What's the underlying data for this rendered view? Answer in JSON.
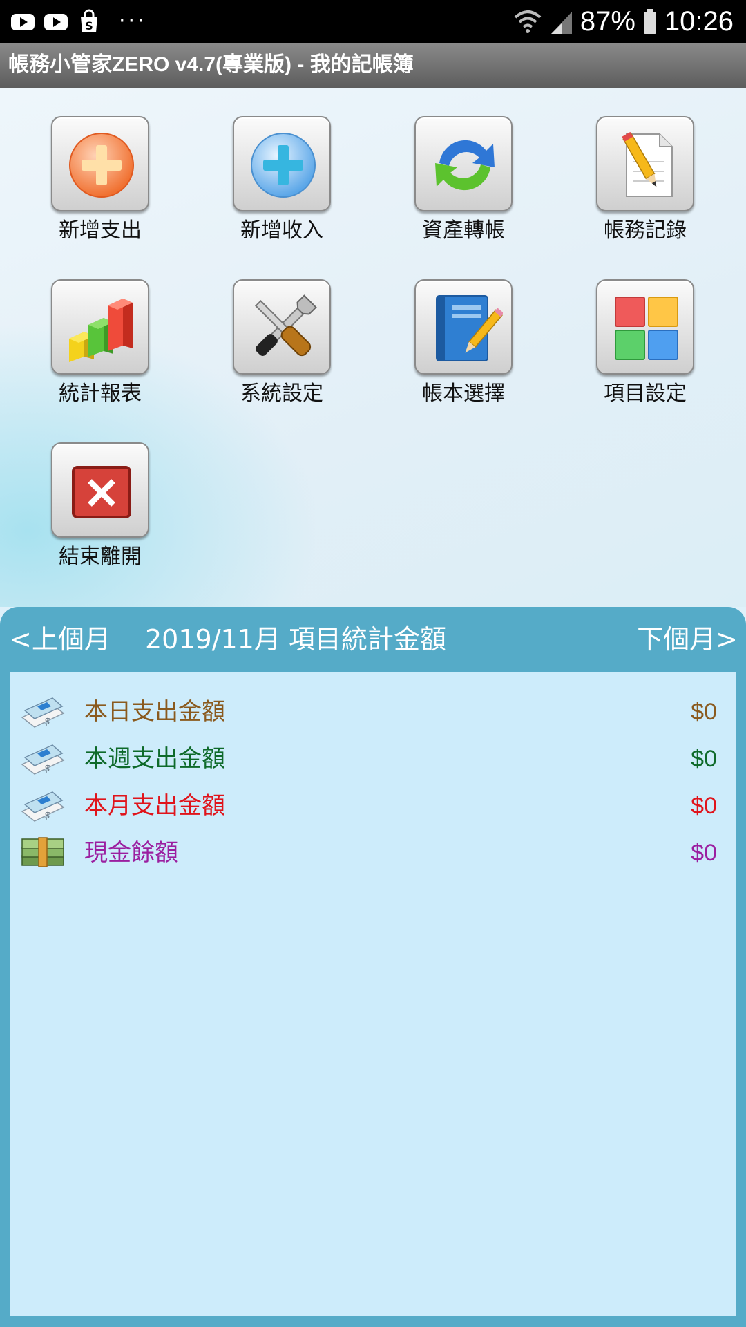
{
  "status_bar": {
    "icons": [
      "youtube-icon",
      "youtube-icon",
      "shopping-bag-icon"
    ],
    "more": "···",
    "battery": "87%",
    "time": "10:26"
  },
  "app": {
    "title": "帳務小管家ZERO v4.7(專業版) - 我的記帳簿"
  },
  "menu": {
    "items": [
      {
        "label": "新增支出",
        "icon": "add-expense-icon"
      },
      {
        "label": "新增收入",
        "icon": "add-income-icon"
      },
      {
        "label": "資產轉帳",
        "icon": "transfer-icon"
      },
      {
        "label": "帳務記錄",
        "icon": "records-icon"
      },
      {
        "label": "統計報表",
        "icon": "report-chart-icon"
      },
      {
        "label": "系統設定",
        "icon": "settings-tools-icon"
      },
      {
        "label": "帳本選擇",
        "icon": "ledger-book-icon"
      },
      {
        "label": "項目設定",
        "icon": "category-grid-icon"
      },
      {
        "label": "結束離開",
        "icon": "exit-icon"
      }
    ]
  },
  "stats": {
    "prev_label": "<上個月",
    "title": "2019/11月 項目統計金額",
    "next_label": "下個月>",
    "rows": [
      {
        "label": "本日支出金額",
        "value": "$0",
        "color": "#8a5a1e",
        "icon": "bill-icon"
      },
      {
        "label": "本週支出金額",
        "value": "$0",
        "color": "#0e6a2a",
        "icon": "bill-icon"
      },
      {
        "label": "本月支出金額",
        "value": "$0",
        "color": "#e0141b",
        "icon": "bill-icon"
      },
      {
        "label": "現金餘額",
        "value": "$0",
        "color": "#9b1fa0",
        "icon": "cash-stack-icon"
      }
    ]
  },
  "colors": {
    "panel": "#55abc8",
    "stats_bg": "#cdecfb",
    "title_bar": "#6e6e6e"
  }
}
